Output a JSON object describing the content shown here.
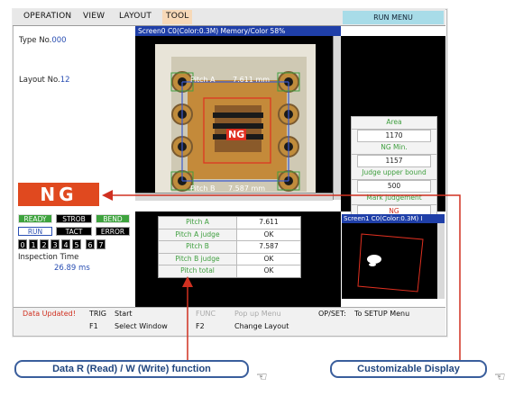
{
  "menu": {
    "items": [
      "OPERATION",
      "VIEW",
      "LAYOUT",
      "TOOL"
    ],
    "run_menu": "RUN MENU"
  },
  "left": {
    "type_label": "Type No.",
    "type_value": "000",
    "layout_label": "Layout No.",
    "layout_value": "12",
    "result": "NG",
    "status": [
      "READY",
      "STROB",
      "BEND",
      "RUN",
      "TACT",
      "ERROR"
    ],
    "channels": [
      "0",
      "1",
      "2",
      "3",
      "4",
      "5",
      "6",
      "7"
    ],
    "inspection_label": "Inspection Time",
    "inspection_value": "26.89 ms"
  },
  "main_view": {
    "title": "Screen0 C0(Color:0.3M) Memory/Color 58%",
    "pitch_a_label": "Pitch A",
    "pitch_a_value": "7.611 mm",
    "pitch_b_label": "Pitch B",
    "pitch_b_value": "7.587 mm",
    "ng_tag": "NG"
  },
  "right_table": [
    {
      "label": "Area",
      "value": "1170"
    },
    {
      "label": "NG Min.",
      "value": "1157"
    },
    {
      "label": "Judge upper bound",
      "value": "500"
    },
    {
      "label": "Mark judgement",
      "value": "NG"
    }
  ],
  "bottom_table": [
    {
      "label": "Pitch A",
      "value": "7.611"
    },
    {
      "label": "Pitch A judge",
      "value": "OK"
    },
    {
      "label": "Pitch B",
      "value": "7.587"
    },
    {
      "label": "Pitch B judge",
      "value": "OK"
    },
    {
      "label": "Pitch total",
      "value": "OK"
    }
  ],
  "sub_view": {
    "title": "Screen1 C0(Color:0.3M) I"
  },
  "footer": {
    "data_updated": "Data Updated!",
    "trig_key": "TRIG",
    "trig_action": "Start",
    "func_key": "FUNC",
    "func_action": "Pop up Menu",
    "op_key": "OP/SET:",
    "op_action": "To SETUP Menu",
    "f1_key": "F1",
    "f1_action": "Select Window",
    "f2_key": "F2",
    "f2_action": "Change Layout"
  },
  "callouts": {
    "left": "Data R (Read) / W (Write) function",
    "right": "Customizable Display"
  },
  "colors": {
    "accent_red": "#d03020",
    "title_blue": "#1f3fa8",
    "status_green": "#3ea33e",
    "callout_blue": "#3a5e9c"
  }
}
